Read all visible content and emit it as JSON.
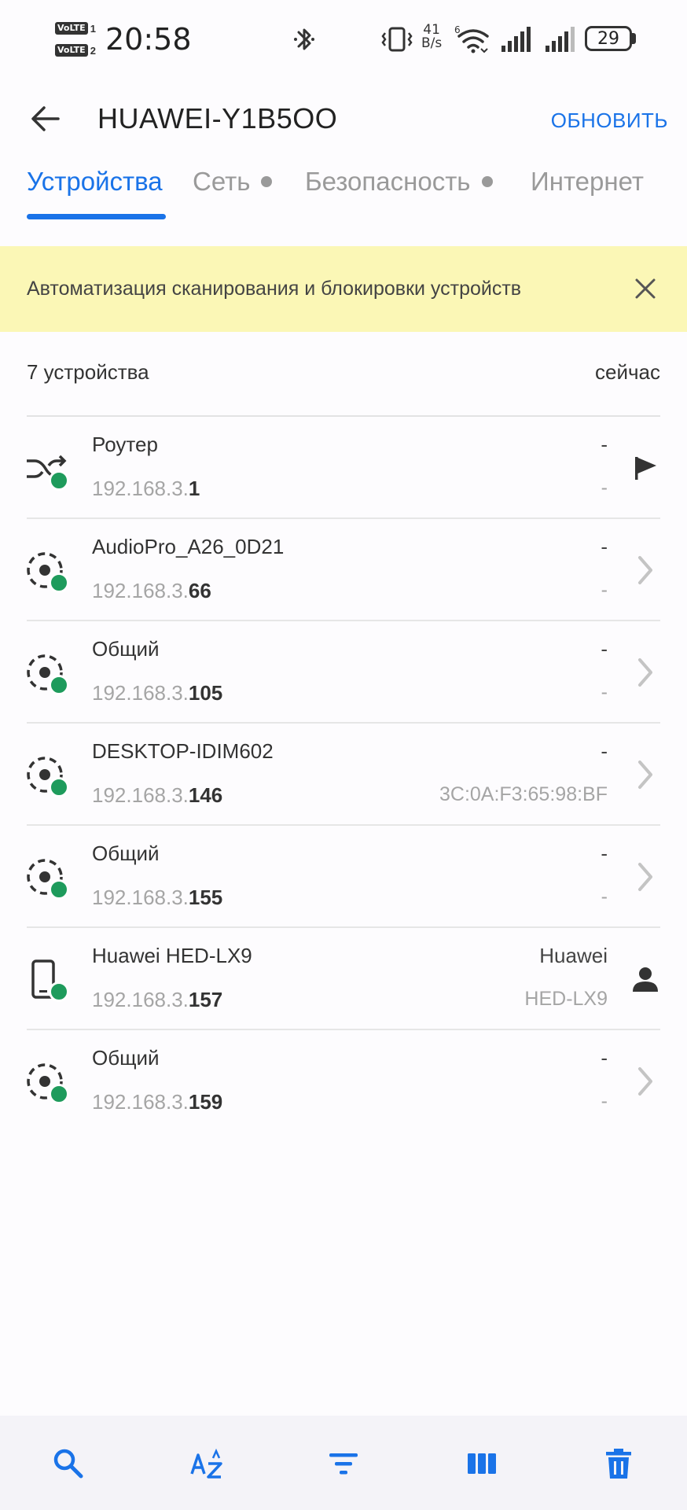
{
  "status_bar": {
    "volte": "VoLTE",
    "sim1": "1",
    "sim2": "2",
    "time": "20:58",
    "speed_value": "41",
    "speed_unit": "B/s",
    "battery": "29",
    "icons": [
      "bluetooth-icon",
      "vibrate-icon",
      "wifi-icon",
      "signal-icon",
      "signal-icon",
      "battery-icon"
    ]
  },
  "header": {
    "title": "HUAWEI-Y1B5OO",
    "refresh_label": "ОБНОВИТЬ"
  },
  "tabs": [
    {
      "label": "Устройства",
      "active": true
    },
    {
      "label": "Сеть",
      "active": false,
      "dot": true
    },
    {
      "label": "Безопасность",
      "active": false,
      "dot": true
    },
    {
      "label": "Интернет",
      "active": false
    }
  ],
  "banner": {
    "text": "Автоматизация сканирования и блокировки устройств"
  },
  "list_header": {
    "count": "7 устройства",
    "updated": "сейчас"
  },
  "devices": [
    {
      "name": "Роутер",
      "ip_prefix": "192.168.3.",
      "ip_suffix": "1",
      "right_top": "-",
      "right_bottom": "-",
      "icon": "router-shuffle-icon",
      "action": "flag-icon",
      "status": "online"
    },
    {
      "name": "AudioPro_A26_0D21",
      "ip_prefix": "192.168.3.",
      "ip_suffix": "66",
      "right_top": "-",
      "right_bottom": "-",
      "icon": "generic-device-icon",
      "action": "chevron-right-icon",
      "status": "online"
    },
    {
      "name": "Общий",
      "ip_prefix": "192.168.3.",
      "ip_suffix": "105",
      "right_top": "-",
      "right_bottom": "-",
      "icon": "generic-device-icon",
      "action": "chevron-right-icon",
      "status": "online"
    },
    {
      "name": "DESKTOP-IDIM602",
      "ip_prefix": "192.168.3.",
      "ip_suffix": "146",
      "right_top": "-",
      "right_bottom": "3C:0A:F3:65:98:BF",
      "icon": "generic-device-icon",
      "action": "chevron-right-icon",
      "status": "online"
    },
    {
      "name": "Общий",
      "ip_prefix": "192.168.3.",
      "ip_suffix": "155",
      "right_top": "-",
      "right_bottom": "-",
      "icon": "generic-device-icon",
      "action": "chevron-right-icon",
      "status": "online"
    },
    {
      "name": "Huawei HED-LX9",
      "ip_prefix": "192.168.3.",
      "ip_suffix": "157",
      "right_top": "Huawei",
      "right_bottom": "HED-LX9",
      "icon": "phone-icon",
      "action": "person-icon",
      "status": "online"
    },
    {
      "name": "Общий",
      "ip_prefix": "192.168.3.",
      "ip_suffix": "159",
      "right_top": "-",
      "right_bottom": "-",
      "icon": "generic-device-icon",
      "action": "chevron-right-icon",
      "status": "online"
    }
  ],
  "bottom_bar": [
    "search-icon",
    "sort-az-icon",
    "filter-icon",
    "columns-icon",
    "trash-icon"
  ],
  "colors": {
    "accent": "#1a73e8",
    "banner_bg": "#fbf7b6",
    "online": "#1e9b5c"
  }
}
